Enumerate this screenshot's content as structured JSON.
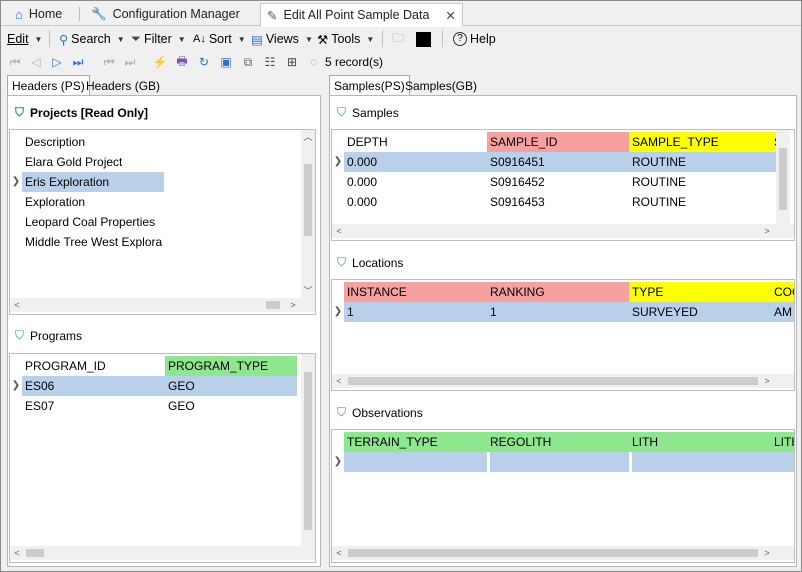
{
  "doc_tabs": {
    "home": "Home",
    "config": "Configuration Manager",
    "edit": "Edit All Point Sample Data"
  },
  "menu": {
    "edit": "Edit",
    "search": "Search",
    "filter": "Filter",
    "sort": "Sort",
    "views": "Views",
    "tools": "Tools",
    "help": "Help"
  },
  "toolbar": {
    "records": "5 record(s)"
  },
  "left_tabs": [
    "Headers (PS)",
    "Headers (GB)"
  ],
  "right_tabs": [
    "Samples(PS)",
    "Samples(GB)"
  ],
  "projects": {
    "title": "Projects [Read Only]",
    "header": "Description",
    "rows": [
      "Elara Gold Project",
      "Eris Exploration",
      "Exploration",
      "Leopard Coal Properties",
      "Middle Tree West Explora"
    ]
  },
  "programs": {
    "title": "Programs",
    "headers": [
      "PROGRAM_ID",
      "PROGRAM_TYPE"
    ],
    "rows": [
      [
        "ES06",
        "GEO"
      ],
      [
        "ES07",
        "GEO"
      ]
    ]
  },
  "samples": {
    "title": "Samples",
    "headers": [
      "DEPTH",
      "SAMPLE_ID",
      "SAMPLE_TYPE",
      "S"
    ],
    "rows": [
      [
        "0.000",
        "S0916451",
        "ROUTINE"
      ],
      [
        "0.000",
        "S0916452",
        "ROUTINE"
      ],
      [
        "0.000",
        "S0916453",
        "ROUTINE"
      ]
    ]
  },
  "locations": {
    "title": "Locations",
    "headers": [
      "INSTANCE",
      "RANKING",
      "TYPE",
      "COO"
    ],
    "rows": [
      [
        "1",
        "1",
        "SURVEYED",
        "AM"
      ]
    ]
  },
  "observations": {
    "title": "Observations",
    "headers": [
      "TERRAIN_TYPE",
      "REGOLITH",
      "LITH",
      "LITH"
    ]
  },
  "colors": {
    "pink": "#f7a0a0",
    "yellow": "#ffff00",
    "green": "#8ee68e",
    "selected": "#b8d0ea"
  }
}
